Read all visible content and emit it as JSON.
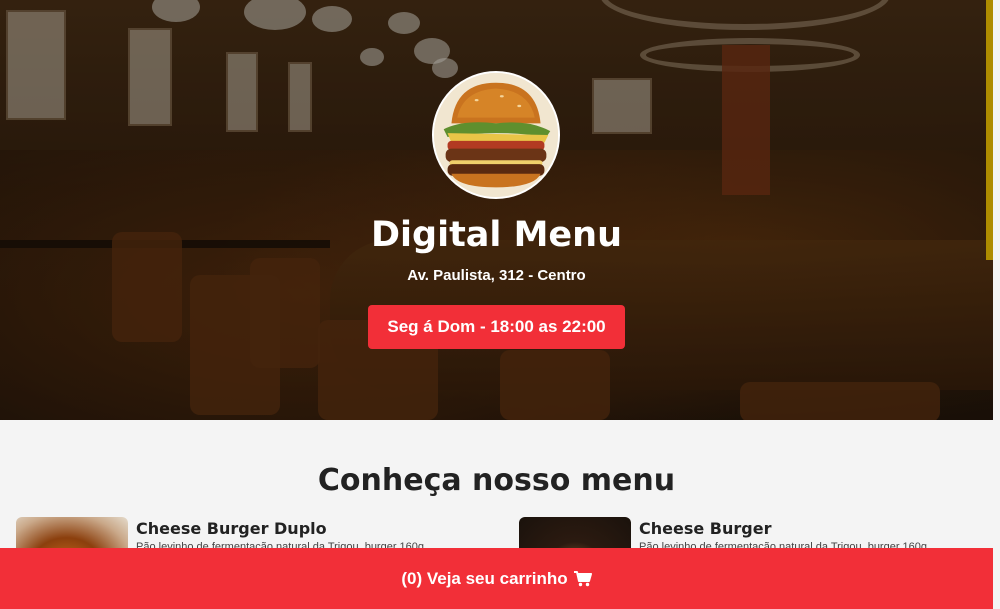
{
  "header": {
    "title": "Digital Menu",
    "address": "Av. Paulista, 312 - Centro",
    "hours": "Seg á Dom - 18:00 as 22:00"
  },
  "menu": {
    "heading": "Conheça nosso menu",
    "products": [
      {
        "name": "Cheese Burger Duplo",
        "description": "Pão levinho de fermentação natural da Trigou, burger 160g"
      },
      {
        "name": "Cheese Burger",
        "description": "Pão levinho de fermentação natural da Trigou, burger 160g"
      }
    ]
  },
  "cart": {
    "label": "(0) Veja seu carrinho",
    "icon": "shopping-cart-icon"
  },
  "colors": {
    "accent": "#f22f38",
    "background": "#f4f4f4",
    "text": "#222222",
    "hero_side_bar": "#f2c200"
  }
}
